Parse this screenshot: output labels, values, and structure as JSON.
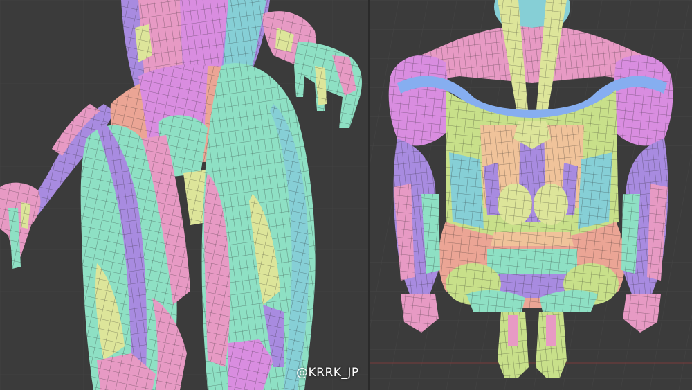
{
  "watermark": {
    "text": "@KRRK_JP"
  },
  "colors": {
    "background": "#3b3b3b",
    "grid": "#464646",
    "pink": "#e79ac4",
    "magenta": "#d98de0",
    "purple": "#a88be0",
    "mint": "#8ee0c4",
    "teal": "#86cfd6",
    "yellow": "#dde59a",
    "lime": "#c8e08a",
    "salmon": "#eba595",
    "peach": "#f0c39a",
    "blue": "#86aef0",
    "wire": "#1e1e1e"
  }
}
